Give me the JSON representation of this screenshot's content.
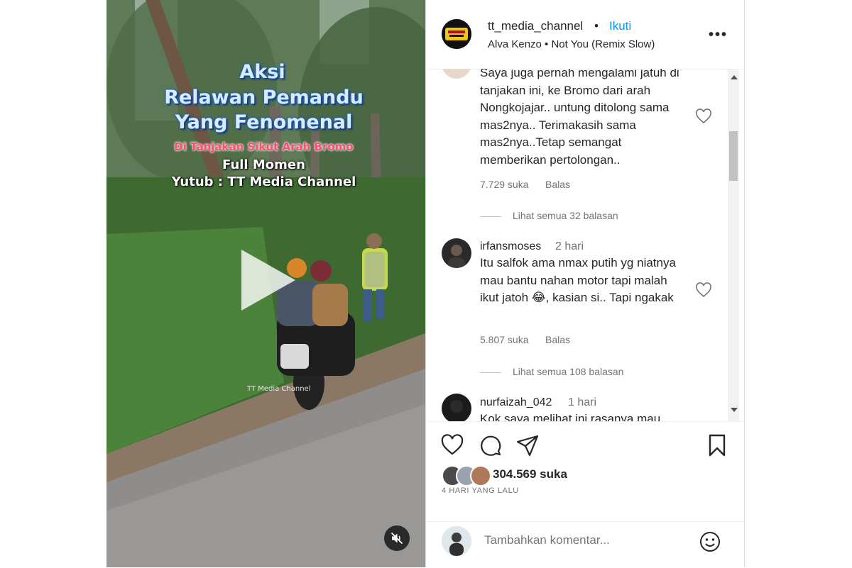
{
  "video": {
    "overlay_lines": [
      "Aksi",
      "Relawan Pemandu",
      "Yang Fenomenal",
      "Di Tanjakan Sikut Arah Bromo",
      "Full Momen",
      "Yutub : TT Media Channel"
    ],
    "watermark": "TT Media Channel",
    "play_icon": "play-icon",
    "mute_icon": "muted-speaker-icon"
  },
  "header": {
    "username": "tt_media_channel",
    "separator": "•",
    "follow_label": "Ikuti",
    "music": "Alva Kenzo • Not You (Remix Slow)",
    "more_label": "•••"
  },
  "comments": [
    {
      "username": "",
      "time": "",
      "text": "Saya juga pernah mengalami jatuh di tanjakan ini, ke Bromo dari arah Nongkojajar.. untung ditolong sama mas2nya.. Terimakasih sama mas2nya..Tetap semangat memberikan pertolongan..",
      "likes": "7.729 suka",
      "reply_label": "Balas",
      "view_replies": "Lihat semua 32 balasan"
    },
    {
      "username": "irfansmoses",
      "time": "2 hari",
      "text": "Itu salfok ama nmax putih yg niatnya mau bantu nahan motor tapi malah ikut jatoh 😂, kasian si.. Tapi ngakak",
      "likes": "5.807 suka",
      "reply_label": "Balas",
      "view_replies": "Lihat semua 108 balasan"
    },
    {
      "username": "nurfaizah_042",
      "time": "1 hari",
      "text": "Kok saya melihat ini rasanya mau",
      "likes": "",
      "reply_label": "",
      "view_replies": ""
    }
  ],
  "actions": {
    "like_icon": "heart-icon",
    "comment_icon": "comment-bubble-icon",
    "share_icon": "paper-plane-icon",
    "save_icon": "bookmark-icon",
    "likes_total": "304.569 suka",
    "posted_ago": "4 HARI YANG LALU"
  },
  "add_comment": {
    "placeholder": "Tambahkan komentar...",
    "emoji_icon": "smiley-icon"
  },
  "colors": {
    "follow_blue": "#0095f6",
    "muted_text": "#737373",
    "primary_text": "#262626"
  }
}
